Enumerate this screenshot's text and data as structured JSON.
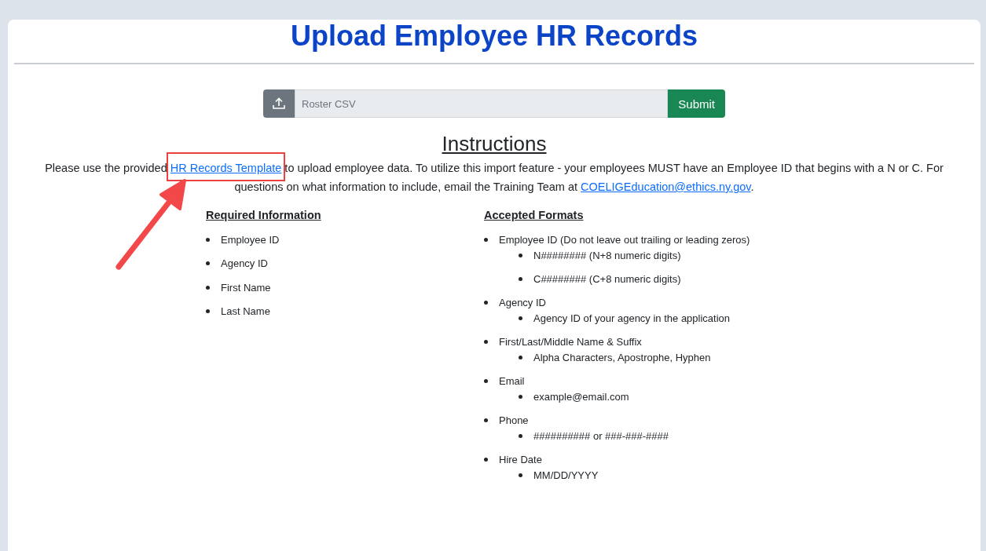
{
  "title": "Upload Employee HR Records",
  "upload": {
    "placeholder": "Roster CSV",
    "submit": "Submit"
  },
  "instructions": {
    "heading": "Instructions",
    "text_before": "Please use the provided ",
    "template_link": "HR Records Template",
    "text_middle": " to upload employee data. To utilize this import feature - your employees MUST have an Employee ID that begins with a N or C. For questions on what information to include, email the Training Team at ",
    "email_link": "COELIGEducation@ethics.ny.gov",
    "text_after": "."
  },
  "required": {
    "heading": "Required Information",
    "items": [
      "Employee ID",
      "Agency ID",
      "First Name",
      "Last Name"
    ]
  },
  "accepted": {
    "heading": "Accepted Formats",
    "items": [
      {
        "label": "Employee ID (Do not leave out trailing or leading zeros)",
        "children": [
          "N######## (N+8 numeric digits)",
          "C######## (C+8 numeric digits)"
        ]
      },
      {
        "label": "Agency ID",
        "children": [
          "Agency ID of your agency in the application"
        ]
      },
      {
        "label": "First/Last/Middle Name & Suffix",
        "children": [
          "Alpha Characters, Apostrophe, Hyphen"
        ]
      },
      {
        "label": "Email",
        "children": [
          "example@email.com"
        ]
      },
      {
        "label": "Phone",
        "children": [
          "########## or ###-###-####"
        ]
      },
      {
        "label": "Hire Date",
        "children": [
          "MM/DD/YYYY"
        ]
      }
    ]
  }
}
